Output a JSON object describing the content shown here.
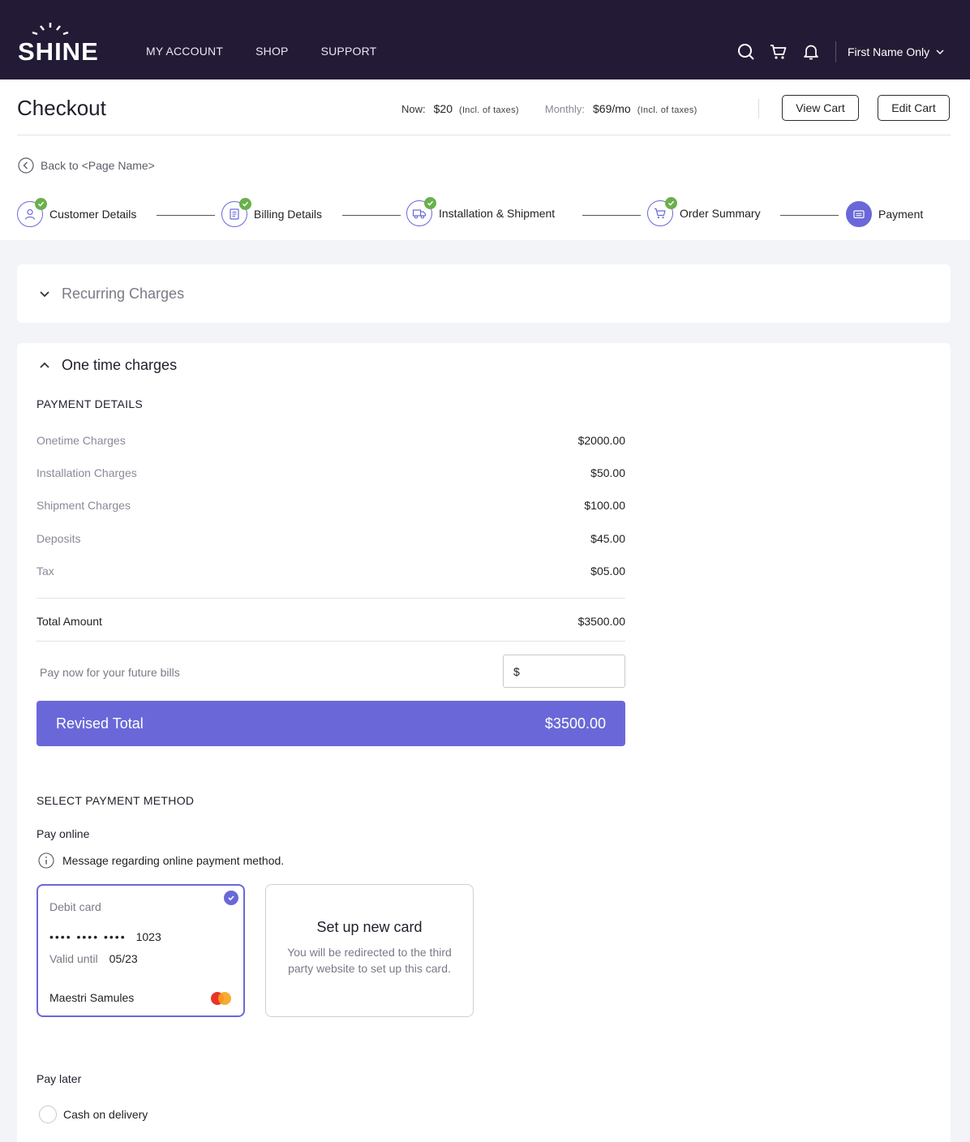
{
  "brand": {
    "name": "SHINE"
  },
  "nav": {
    "items": [
      "MY ACCOUNT",
      "SHOP",
      "SUPPORT"
    ]
  },
  "user": {
    "name": "First Name Only"
  },
  "header": {
    "title": "Checkout",
    "now_label": "Now:",
    "now_value": "$20",
    "now_tax": "(Incl. of taxes)",
    "monthly_label": "Monthly:",
    "monthly_value": "$69/mo",
    "monthly_tax": "(Incl. of taxes)",
    "view_cart": "View Cart",
    "edit_cart": "Edit Cart",
    "back_label": "Back to <Page Name>"
  },
  "steps": [
    {
      "label": "Customer Details",
      "icon": "user-icon",
      "completed": true
    },
    {
      "label": "Billing Details",
      "icon": "receipt-icon",
      "completed": true
    },
    {
      "label": "Installation & Shipment",
      "icon": "truck-icon",
      "completed": true
    },
    {
      "label": "Order Summary",
      "icon": "cart-icon",
      "completed": true
    },
    {
      "label": "Payment",
      "icon": "card-icon",
      "completed": false,
      "active": true
    }
  ],
  "recurring": {
    "title": "Recurring Charges"
  },
  "onetime": {
    "title": "One time charges",
    "payment_details_title": "PAYMENT DETAILS",
    "rows": [
      {
        "label": "Onetime Charges",
        "value": "$2000.00"
      },
      {
        "label": "Installation Charges",
        "value": "$50.00"
      },
      {
        "label": "Shipment Charges",
        "value": "$100.00"
      },
      {
        "label": "Deposits",
        "value": "$45.00"
      },
      {
        "label": "Tax",
        "value": "$05.00"
      }
    ],
    "total_label": "Total Amount",
    "total_value": "$3500.00",
    "pay_now_label": "Pay now for your future bills",
    "pay_now_value": "$",
    "revised_label": "Revised Total",
    "revised_value": "$3500.00"
  },
  "payment_method": {
    "title": "SELECT PAYMENT METHOD",
    "online_label": "Pay online",
    "info_message": "Message regarding online payment method.",
    "debit_card": {
      "type": "Debit card",
      "masked": "•••• •••• ••••",
      "last4": "1023",
      "valid_label": "Valid until",
      "valid_value": "05/23",
      "holder": "Maestri Samules"
    },
    "new_card": {
      "title": "Set up new card",
      "description": "You will be redirected to the third party website to set up this card."
    },
    "later_label": "Pay later",
    "cod_label": "Cash on delivery"
  },
  "colors": {
    "nav_bg": "#231b35",
    "accent": "#6a68d8",
    "check": "#6ab04c"
  }
}
